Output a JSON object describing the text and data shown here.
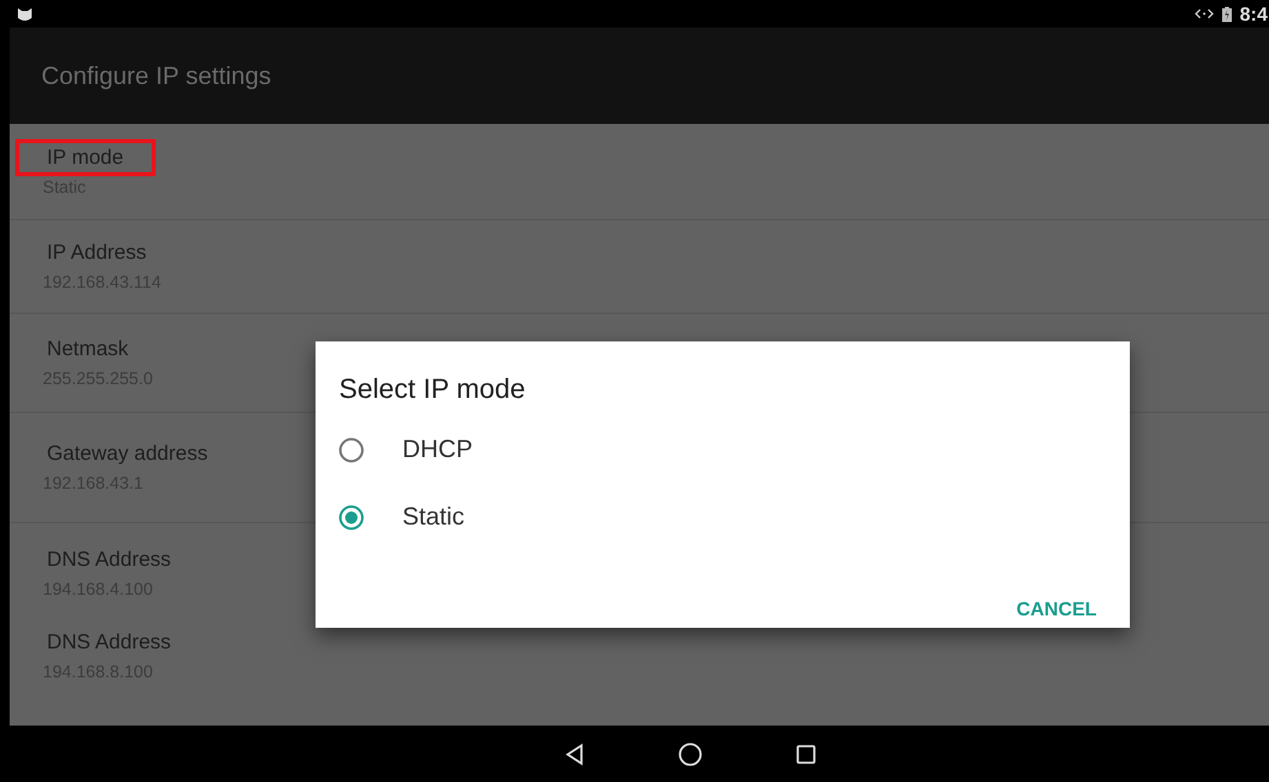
{
  "status_bar": {
    "time": "8:4"
  },
  "app_bar": {
    "title": "Configure IP settings"
  },
  "settings": [
    {
      "title": "IP mode",
      "value": "Static",
      "highlighted": true
    },
    {
      "title": "IP Address",
      "value": "192.168.43.114",
      "highlighted": false
    },
    {
      "title": "Netmask",
      "value": "255.255.255.0",
      "highlighted": false
    },
    {
      "title": "Gateway address",
      "value": "192.168.43.1",
      "highlighted": false
    },
    {
      "title": "DNS Address",
      "value": "194.168.4.100",
      "highlighted": false
    },
    {
      "title": "DNS Address",
      "value": "194.168.8.100",
      "highlighted": false
    }
  ],
  "dialog": {
    "title": "Select IP mode",
    "options": [
      {
        "label": "DHCP",
        "selected": false
      },
      {
        "label": "Static",
        "selected": true
      }
    ],
    "buttons": [
      "CANCEL"
    ]
  }
}
